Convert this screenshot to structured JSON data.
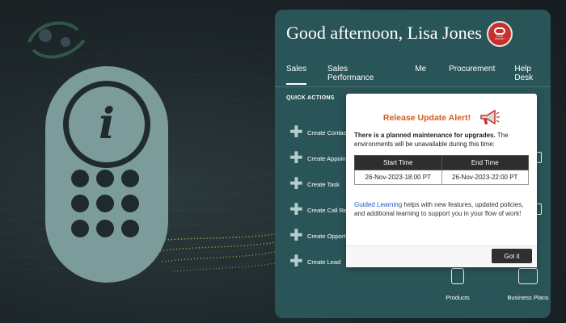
{
  "panel": {
    "greeting": "Good afternoon, Lisa Jones",
    "badge": {
      "line1": "START",
      "line2": "SURVEY",
      "color": "#c7302b"
    }
  },
  "tabs": [
    {
      "label": "Sales",
      "active": true
    },
    {
      "label": "Sales Performance",
      "active": false
    },
    {
      "label": "Me",
      "active": false
    },
    {
      "label": "Procurement",
      "active": false
    },
    {
      "label": "Help Desk",
      "active": false
    }
  ],
  "quick_actions": {
    "title": "QUICK ACTIONS",
    "items": [
      {
        "label": "Create Contact",
        "icon": "plus-icon"
      },
      {
        "label": "Create Appoint",
        "icon": "plus-icon"
      },
      {
        "label": "Create Task",
        "icon": "plus-icon"
      },
      {
        "label": "Create Call Rep",
        "icon": "plus-icon"
      },
      {
        "label": "Create Opport",
        "icon": "plus-icon"
      },
      {
        "label": "Create Lead",
        "icon": "plus-icon"
      }
    ]
  },
  "tiles": [
    {
      "label": "Products",
      "icon": "phone-icon"
    },
    {
      "label": "Business Plans",
      "icon": "briefcase-icon"
    }
  ],
  "modal": {
    "title": "Release Update Alert!",
    "icon": "megaphone-icon",
    "message_bold": "There is a planned maintenance for upgrades.",
    "message_rest": " The environments will be unavailable during this time:",
    "table": {
      "headers": [
        "Start Time",
        "End Time"
      ],
      "rows": [
        [
          "26-Nov-2023-18:00 PT",
          "26-Nov-2023-22:00 PT"
        ]
      ]
    },
    "link_text": "Guided Learning",
    "note_rest": " helps with new features, updated policies, and additional learning to support you in your flow of work!",
    "button": "Got it"
  },
  "colors": {
    "panel_bg": "#2a5558",
    "device": "#7b9c9b",
    "alert_title": "#d05b1d",
    "link": "#1a55c4"
  }
}
